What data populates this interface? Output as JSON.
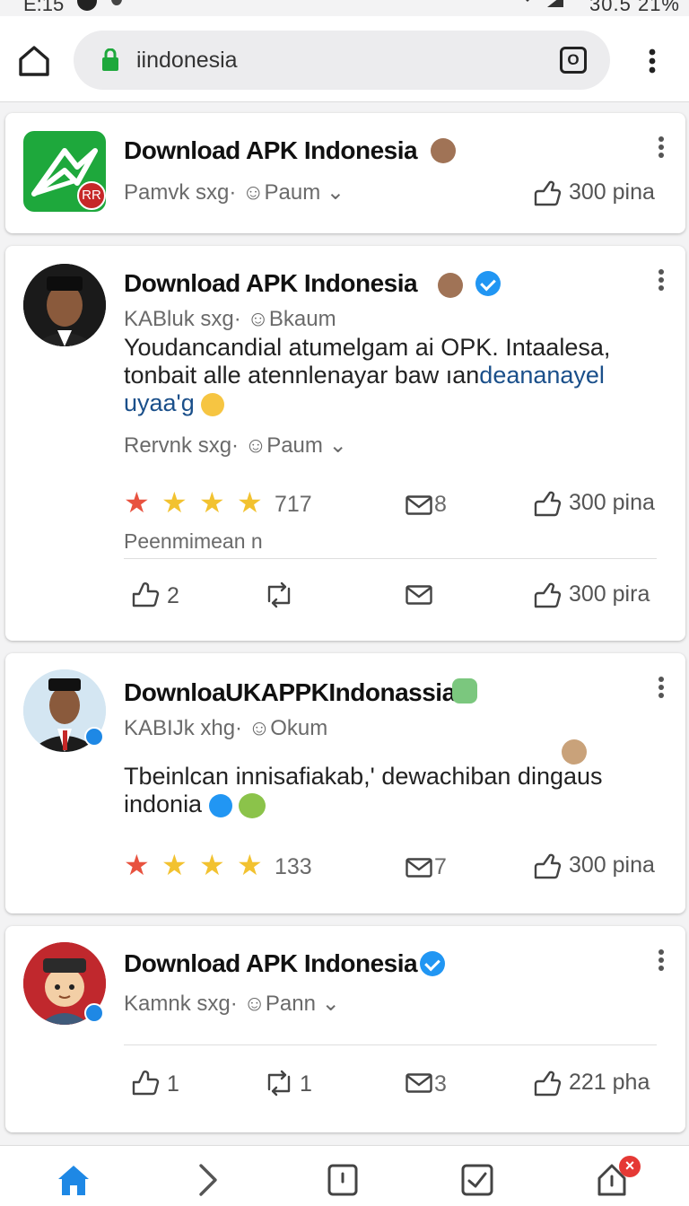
{
  "status_bar": {
    "time": "E:15",
    "right_text": "30.5 21%"
  },
  "browser": {
    "url": "iindonesia",
    "tab_icon_label": "O"
  },
  "cards": [
    {
      "name": "Download APK Indonesia",
      "meta": "Pamvk sxg· ☺Paum ⌄",
      "share": "300 pina"
    },
    {
      "name": "Download APK Indonesia",
      "meta": "KABluk sxg· ☺Bkaum",
      "text_line1": "Youdancandial atumelgam ai OPK. Intaalesa,",
      "text_line2_plain": "tonbait alle atennlenayar baw ıan",
      "text_line2_link": "deananayel",
      "text_line3_link": "uyaa'g",
      "meta2": "Rervnk sxg· ☺Paum ⌄",
      "rating_count": "717",
      "messages": "8",
      "share": "300 pina",
      "subline": "Peenmimean n",
      "like_count": "2",
      "retweet_count": "",
      "share2": "300 pira"
    },
    {
      "name": "DownloaUKAPPKIndonassia",
      "meta": "KABIJk xhg· ☺Okum",
      "text_line1": "Tbeinlcan innisafiakab,' dewachiban dingaus",
      "text_line2": "indonia",
      "rating_count": "133",
      "messages": "7",
      "share": "300 pina"
    },
    {
      "name": "Download APK Indonesia",
      "meta": "Kamnk sxg· ☺Pann ⌄",
      "like_count": "1",
      "retweet_count": "1",
      "messages": "3",
      "share": "221 pha"
    }
  ],
  "nav": {
    "badge": "×"
  },
  "colors": {
    "accent": "#1e88e5",
    "star_red": "#e8523f",
    "star_gold": "#f2c230",
    "app_green": "#1ea83c"
  }
}
